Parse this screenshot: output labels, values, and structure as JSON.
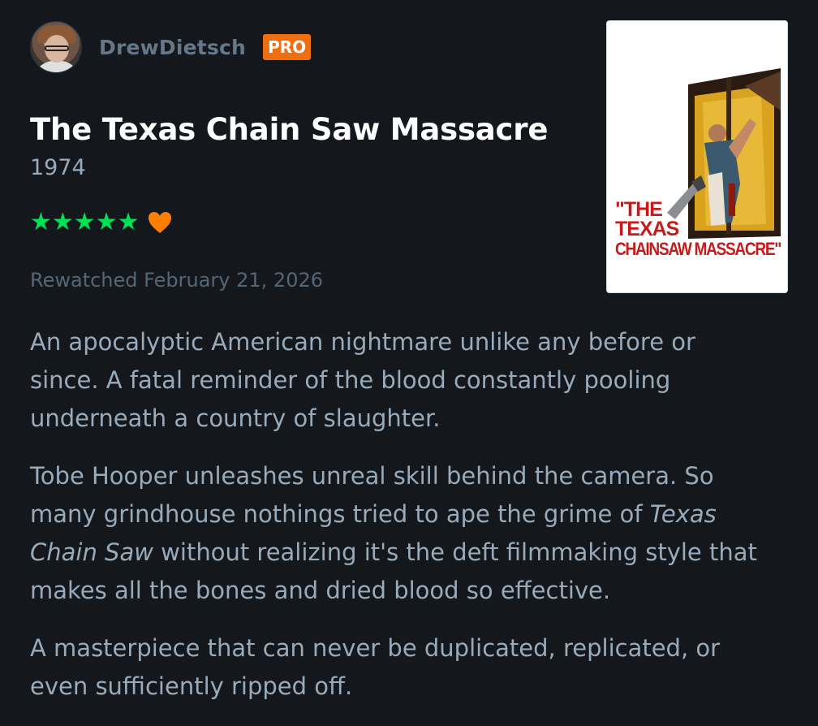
{
  "user": {
    "name": "DrewDietsch",
    "badge": "PRO"
  },
  "film": {
    "title": "The Texas Chain Saw Massacre",
    "year": "1974",
    "poster_text": [
      "\"THE",
      "TEXAS",
      "CHAINSAW MASSACRE\""
    ]
  },
  "rating": {
    "stars": "★★★★★",
    "value": 5,
    "liked": true,
    "icon": "heart-icon",
    "star_color": "#00e054",
    "heart_color": "#ff8000"
  },
  "watched_label": "Rewatched February 21, 2026",
  "review": {
    "p1": "An apocalyptic American nightmare unlike any before or since. A fatal reminder of the blood constantly pooling underneath a country of slaughter.",
    "p2_before": "Tobe Hooper unleashes unreal skill behind the camera. So many grindhouse nothings tried to ape the grime of ",
    "p2_italic": "Texas Chain Saw",
    "p2_after": " without realizing it's the deft filmmaking style that makes all the bones and dried blood so effective.",
    "p3": "A masterpiece that can never be duplicated, replicated, or even sufficiently ripped off."
  }
}
